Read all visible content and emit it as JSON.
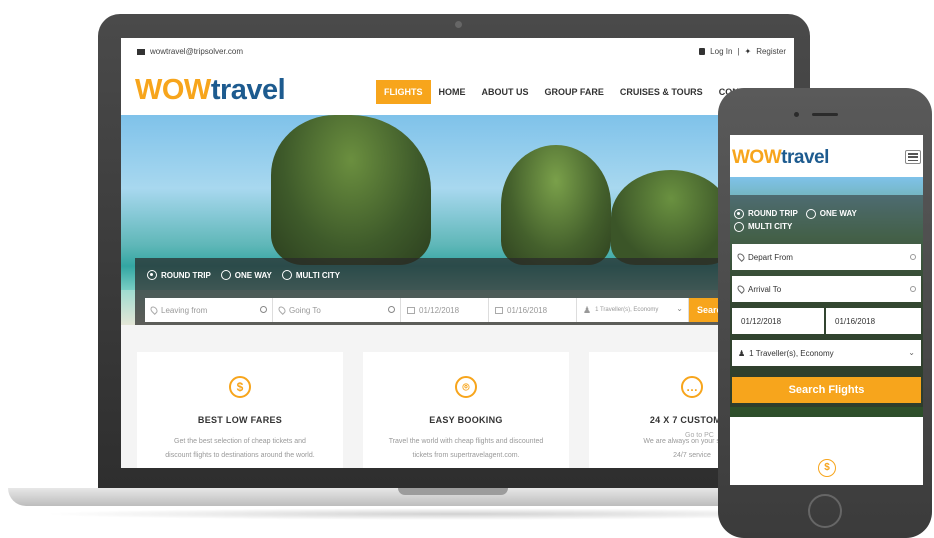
{
  "colors": {
    "accent": "#f7a51c",
    "brand_blue": "#1d5b8f",
    "panel_dark": "#2f2f2f"
  },
  "laptop": {
    "topbar": {
      "email": "wowtravel@tripsolver.com",
      "login": "Log In",
      "separator": "|",
      "register": "Register"
    },
    "logo": {
      "part1": "WOW",
      "part2": "travel"
    },
    "nav": [
      "FLIGHTS",
      "HOME",
      "ABOUT US",
      "GROUP FARE",
      "CRUISES & TOURS",
      "CONTACT US"
    ],
    "search": {
      "trip_types": [
        "ROUND TRIP",
        "ONE WAY",
        "MULTI CITY"
      ],
      "selected_trip_type": "ROUND TRIP",
      "leaving_placeholder": "Leaving from",
      "going_placeholder": "Going To",
      "depart_date": "01/12/2018",
      "return_date": "01/16/2018",
      "travellers": "1 Traveller(s), Economy",
      "search_label": "Search"
    },
    "features": [
      {
        "icon": "dollar-icon",
        "title": "BEST LOW FARES",
        "desc_line1": "Get the best selection of cheap tickets and",
        "desc_line2": "discount flights to destinations around the world."
      },
      {
        "icon": "map-pin-icon",
        "title": "EASY BOOKING",
        "desc_line1": "Travel the world with cheap flights and discounted",
        "desc_line2": "tickets from supertravelagent.com."
      },
      {
        "icon": "chat-bubble-icon",
        "title": "24 X 7 CUSTOMER",
        "desc_line1": "We are always on your side, ca",
        "desc_line2": "24/7 service"
      }
    ],
    "overlay_text": "Go to PC"
  },
  "phone": {
    "logo": {
      "part1": "WOW",
      "part2": "travel"
    },
    "trip_types": [
      "ROUND TRIP",
      "ONE WAY",
      "MULTI CITY"
    ],
    "selected_trip_type": "ROUND TRIP",
    "depart_placeholder": "Depart From",
    "arrival_placeholder": "Arrival To",
    "depart_date": "01/12/2018",
    "return_date": "01/16/2018",
    "travellers": "1 Traveller(s), Economy",
    "search_label": "Search Flights"
  }
}
